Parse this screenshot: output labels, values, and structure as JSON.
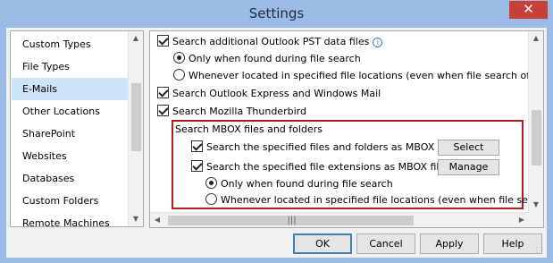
{
  "window": {
    "title": "Settings",
    "close_label": "✕"
  },
  "sidebar": {
    "items": [
      {
        "label": "Custom Types"
      },
      {
        "label": "File Types"
      },
      {
        "label": "E-Mails",
        "selected": true
      },
      {
        "label": "Other Locations"
      },
      {
        "label": "SharePoint"
      },
      {
        "label": "Websites"
      },
      {
        "label": "Databases"
      },
      {
        "label": "Custom Folders"
      },
      {
        "label": "Remote Machines"
      }
    ]
  },
  "options": {
    "search_pst": "Search additional Outlook PST data files",
    "pst_only_found": "Only when found during file search",
    "pst_whenever": "Whenever located in specified file locations (even when file search off)",
    "search_outlook_express": "Search Outlook Express and Windows Mail",
    "search_thunderbird": "Search Mozilla Thunderbird",
    "mbox_group_label": "Search MBOX files and folders",
    "mbox_specified_files": "Search the specified files and folders as MBOX files:",
    "mbox_specified_extensions": "Search the specified file extensions as MBOX files:",
    "mbox_only_found": "Only when found during file search",
    "mbox_whenever": "Whenever located in specified file locations (even when file search off)",
    "select_button": "Select",
    "manage_button": "Manage"
  },
  "footer": {
    "ok": "OK",
    "cancel": "Cancel",
    "apply": "Apply",
    "help": "Help"
  },
  "icons": {
    "info": "info-icon",
    "up": "chevron-up-icon",
    "down": "chevron-down-icon",
    "left": "chevron-left-icon",
    "right": "chevron-right-icon"
  },
  "colors": {
    "highlight_border": "#b01e1e",
    "selected_item": "#cde3f7",
    "close_button": "#c7413a",
    "frame": "#9bbbe7"
  }
}
